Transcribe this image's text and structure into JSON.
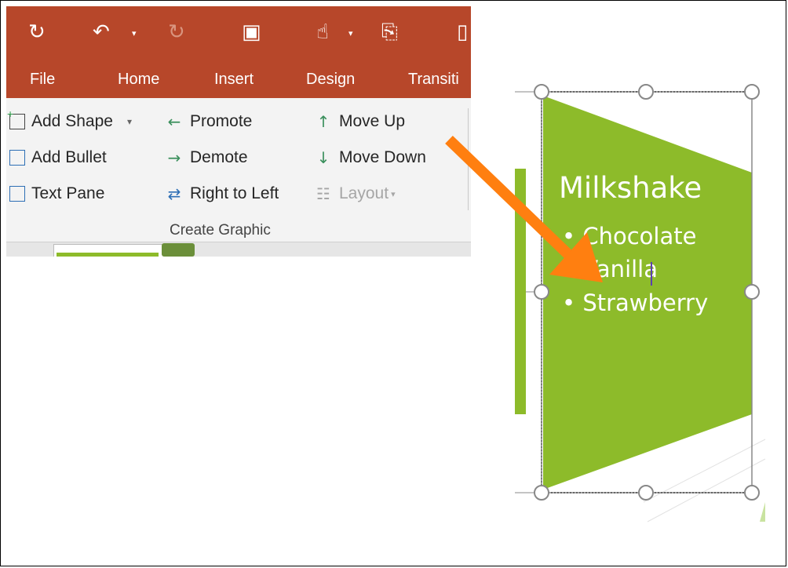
{
  "tabs": [
    "File",
    "Home",
    "Insert",
    "Design",
    "Transiti"
  ],
  "quick_access": {
    "save_icon": "save-sync-icon",
    "undo_icon": "undo-icon",
    "redo_icon": "redo-icon",
    "present_icon": "present-from-start-icon",
    "touch_icon": "touch-mode-icon",
    "attach_icon": "attachment-icon"
  },
  "commands": {
    "add_shape": "Add Shape",
    "add_bullet": "Add Bullet",
    "text_pane": "Text Pane",
    "promote": "Promote",
    "demote": "Demote",
    "right_to_left": "Right to Left",
    "move_up": "Move Up",
    "move_down": "Move Down",
    "layout": "Layout"
  },
  "group_label": "Create Graphic",
  "slide": {
    "title": "Milkshake",
    "bullets": [
      "Chocolate",
      "Vanilla",
      "Strawberry"
    ]
  },
  "colors": {
    "ribbon_red": "#b7472a",
    "shape_green": "#8dbb2a",
    "arrow_orange": "#ff7f10",
    "selection_gray": "#888888"
  }
}
